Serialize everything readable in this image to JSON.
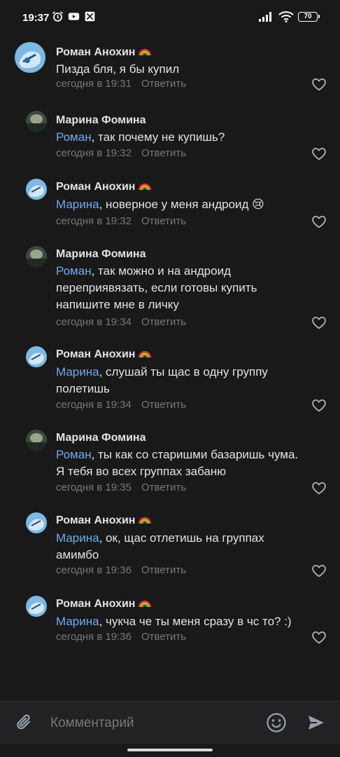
{
  "status_bar": {
    "time": "19:37",
    "battery": "70"
  },
  "comments": [
    {
      "author": "Роман Анохин",
      "mention": "",
      "text": "Пизда бля, я бы купил",
      "time": "сегодня в 19:31",
      "reply": "Ответить",
      "avatar": "blue"
    },
    {
      "author": "Марина Фомина",
      "mention": "Роман",
      "text": ", так почему не купишь?",
      "time": "сегодня в 19:32",
      "reply": "Ответить",
      "avatar": "green"
    },
    {
      "author": "Роман Анохин",
      "mention": "Марина",
      "text": ",  новерное у меня андроид 😢",
      "time": "сегодня в 19:32",
      "reply": "Ответить",
      "avatar": "blue"
    },
    {
      "author": "Марина Фомина",
      "mention": "Роман",
      "text": ", так можно и на андроид\nпереприявязать, если готовы купить\nнапишите мне в личку",
      "time": "сегодня в 19:34",
      "reply": "Ответить",
      "avatar": "green"
    },
    {
      "author": "Роман Анохин",
      "mention": "Марина",
      "text": ",  слушай ты щас в одну группу\nполетишь",
      "time": "сегодня в 19:34",
      "reply": "Ответить",
      "avatar": "blue"
    },
    {
      "author": "Марина Фомина",
      "mention": "Роман",
      "text": ", ты как со старишми базаришь чума.\nЯ тебя во всех группах забаню",
      "time": "сегодня в 19:35",
      "reply": "Ответить",
      "avatar": "green"
    },
    {
      "author": "Роман Анохин",
      "mention": "Марина",
      "text": ",  ок,  щас отлетишь  на группах\nамимбо",
      "time": "сегодня в 19:36",
      "reply": "Ответить",
      "avatar": "blue"
    },
    {
      "author": "Роман Анохин",
      "mention": "Марина",
      "text": ",  чукча че ты меня сразу в чс то? :)",
      "time": "сегодня в 19:36",
      "reply": "Ответить",
      "avatar": "blue"
    }
  ],
  "composer": {
    "placeholder": "Комментарий"
  },
  "colors": {
    "mention": "#71aaeb",
    "muted": "#76787a",
    "background": "#19191a"
  }
}
